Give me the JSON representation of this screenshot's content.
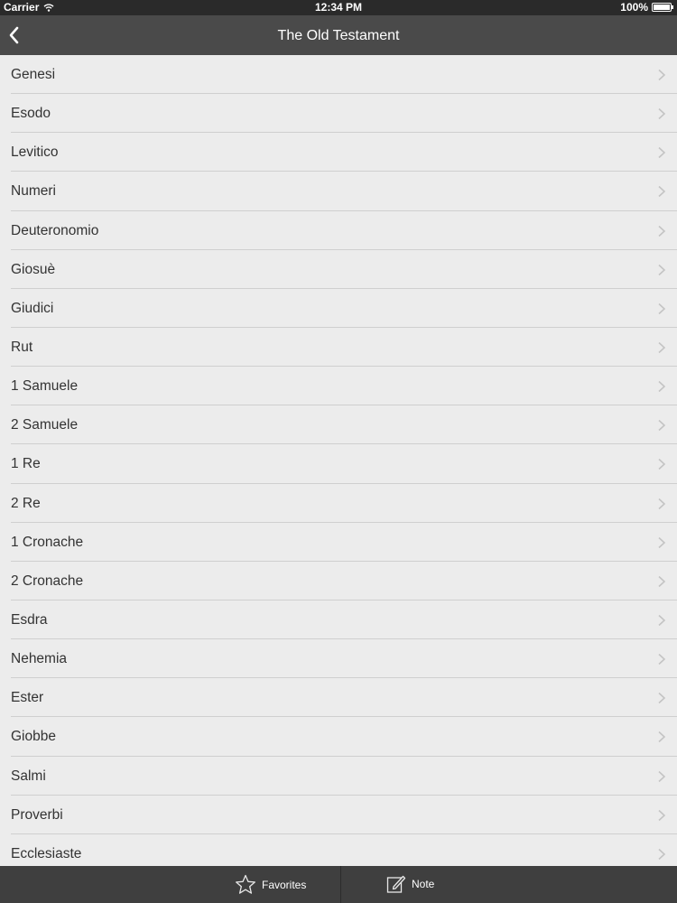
{
  "status_bar": {
    "carrier": "Carrier",
    "time": "12:34 PM",
    "battery": "100%"
  },
  "nav": {
    "title": "The Old Testament",
    "back_icon": "chevron-left-icon"
  },
  "books": [
    "Genesi",
    "Esodo",
    "Levitico",
    "Numeri",
    "Deuteronomio",
    "Giosuè",
    "Giudici",
    "Rut",
    "1 Samuele",
    "2 Samuele",
    "1 Re",
    "2 Re",
    "1 Cronache",
    "2 Cronache",
    "Esdra",
    "Nehemia",
    "Ester",
    "Giobbe",
    "Salmi",
    "Proverbi",
    "Ecclesiaste"
  ],
  "tab_bar": {
    "favorites_label": "Favorites",
    "note_label": "Note",
    "favorites_icon": "star-icon",
    "note_icon": "edit-note-icon"
  },
  "colors": {
    "nav_background": "#4a4a4a",
    "list_background": "#ececec",
    "tab_background": "#3f3f3f"
  }
}
